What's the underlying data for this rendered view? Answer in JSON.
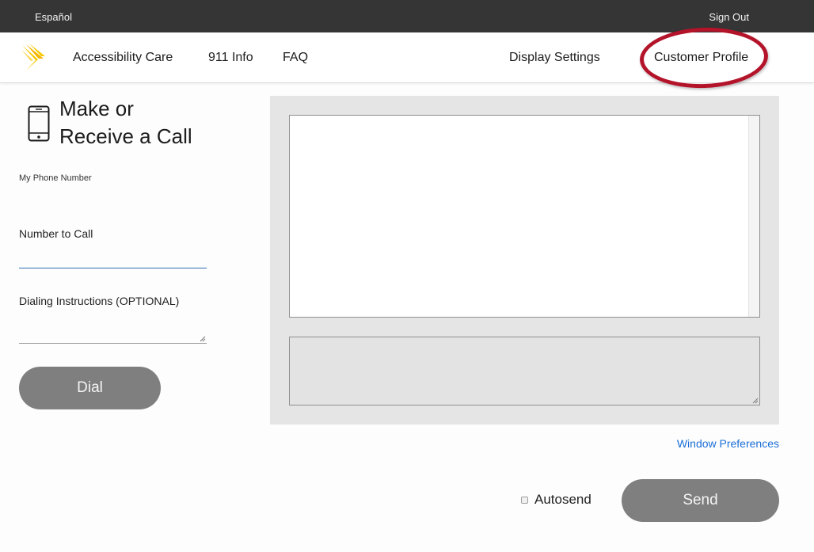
{
  "topbar": {
    "language_link": "Español",
    "sign_out": "Sign Out"
  },
  "nav": {
    "items": [
      {
        "label": "Accessibility Care"
      },
      {
        "label": "911 Info"
      },
      {
        "label": "FAQ"
      },
      {
        "label": "Display Settings"
      },
      {
        "label": "Customer Profile"
      }
    ],
    "highlighted_item": "Customer Profile",
    "highlight_color": "#b3142a"
  },
  "logo": {
    "icon": "sprint-logo-icon",
    "color": "#f7c800"
  },
  "call_panel": {
    "title_line1": "Make or",
    "title_line2": "Receive a Call",
    "icon": "smartphone-icon",
    "my_phone_label": "My Phone Number",
    "my_phone_value": "",
    "number_to_call_label": "Number to Call",
    "number_to_call_value": "",
    "dialing_instructions_label": "Dialing Instructions (OPTIONAL)",
    "dialing_instructions_value": "",
    "dial_button": "Dial"
  },
  "conversation": {
    "transcript_text": "",
    "compose_text": ""
  },
  "footer": {
    "window_preferences": "Window Preferences",
    "autosend_label": "Autosend",
    "autosend_checked": false,
    "send_button": "Send"
  },
  "colors": {
    "topbar": "#353535",
    "button": "#7f7f7f",
    "link": "#1a6ed6",
    "panel": "#e5e5e5"
  }
}
